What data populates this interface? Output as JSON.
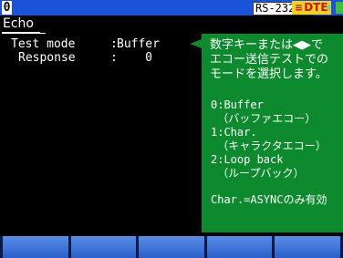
{
  "status_bar": {
    "page_number": "0",
    "rs_badge": "RS-232C",
    "rs_arrow": "⬏",
    "dte_badge": "DTE"
  },
  "tab": {
    "label": "Echo"
  },
  "fields": [
    {
      "label": "Test mode",
      "colon": ":",
      "value": "Buffer"
    },
    {
      "label": "Response",
      "colon": ":",
      "value": "0"
    }
  ],
  "help": {
    "intro": "数字キーまたは◀▶で\nエコー送信テストでの\nモードを選択します。",
    "options": "0:Buffer\n （バッファエコー）\n1:Char.\n （キャラクタエコー）\n2:Loop back\n （ループバック）",
    "note": "Char.=ASYNCのみ有効"
  },
  "function_keys": [
    "",
    "",
    "",
    "",
    ""
  ],
  "colors": {
    "top_bar": "#1a52d8",
    "help_panel": "#0d8a2e",
    "dte_badge": "#f2d02a"
  }
}
